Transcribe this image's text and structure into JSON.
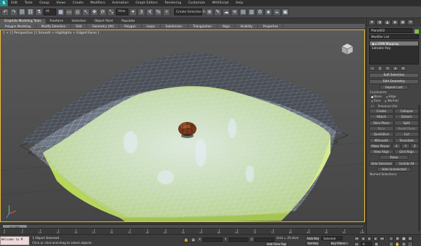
{
  "app": {
    "icon_letter": "S"
  },
  "menu": [
    "Edit",
    "Tools",
    "Group",
    "Views",
    "Create",
    "Modifiers",
    "Animation",
    "Graph Editors",
    "Rendering",
    "Customize",
    "MAXScript",
    "Help"
  ],
  "toolbar": {
    "buttons": [
      "↶",
      "↷",
      "⛓",
      "⛓",
      "⚗",
      "All",
      "▦",
      "▭",
      "◎",
      "↖",
      "✥",
      "⟳",
      "⤡",
      "View",
      "✦",
      "3",
      "∢",
      "%",
      "✧",
      "⊕",
      "✎",
      "☁",
      "≋",
      "▤",
      "▥",
      "⚙",
      "◈",
      "☕",
      "▣"
    ],
    "filter_dropdown": "All",
    "ref_dropdown": "View",
    "named_sel_dropdown": "Create Selection Se"
  },
  "ribbon": {
    "tabs": [
      "Graphite Modeling Tools",
      "Freeform",
      "Selection",
      "Object Paint",
      "Populate"
    ],
    "active_tab": 0,
    "panels": [
      "Polygon Modeling",
      "Modify Selection",
      "Edit",
      "Geometry (All)",
      "Polygon",
      "Loops",
      "Subdivision",
      "Triangulation",
      "Align",
      "Visibility",
      "Properties"
    ]
  },
  "viewport": {
    "label": "[ + ] [ Perspective ] [ Smooth + Highlights + Edged Faces ]",
    "active_border_color": "#f0c040",
    "mesh_color": "#d8e6f7",
    "ground_color": "#c6df8c",
    "ground_edge_color": "#dff27a",
    "dome_color": "#7a3a1e"
  },
  "command_panel": {
    "tab_icons": [
      "✚",
      "◑",
      "▲",
      "◉",
      "▣",
      "⚒"
    ],
    "object_name": "Plane002",
    "object_color": "#7cc43a",
    "modifier_list_label": "Modifier List",
    "stack": [
      {
        "label": "◉ ▸ UVW Mapping",
        "selected": true
      },
      {
        "label": "  Editable Poly",
        "selected": false
      }
    ],
    "stack_icons": [
      "⊣",
      "‖",
      "∀",
      "⊕",
      "☰"
    ],
    "rollouts": {
      "soft_selection": "Soft Selection",
      "edit_geometry": "Edit Geometry"
    },
    "repeat_last": "Repeat Last",
    "constraints_label": "Constraints",
    "constraint_options": [
      "None",
      "Edge",
      "Face",
      "Normal"
    ],
    "preserve_uvs": "Preserve UVs",
    "buttons": {
      "create": "Create",
      "collapse": "Collapse",
      "attach": "Attach",
      "detach": "Detach",
      "slice_plane": "Slice Plane",
      "split": "Split",
      "slice": "Slice",
      "reset_plane": "Reset Plane",
      "quickslice": "QuickSlice",
      "cut": "Cut",
      "msmooth": "MSmooth",
      "tessellate": "Tessellate",
      "make_planar": "Make Planar",
      "x": "X",
      "y": "Y",
      "z": "Z",
      "view_align": "View Align",
      "grid_align": "Grid Align",
      "relax": "Relax",
      "hide_selected": "Hide Selected",
      "unhide_all": "Unhide All",
      "hide_unselected": "Hide Unselected"
    },
    "named_selections": "Named Selections:"
  },
  "timeline": {
    "frame_readout": "0 / 100",
    "ticks": [
      "0",
      "5",
      "10",
      "15",
      "20",
      "25",
      "30",
      "35",
      "40",
      "45",
      "50",
      "55",
      "60",
      "65",
      "70",
      "75",
      "80",
      "85",
      "90",
      "95",
      "100"
    ]
  },
  "status": {
    "maxscript_text": "Welcome to M",
    "line1": "1 Object Selected",
    "line2": "Click or click-and-drag to select objects",
    "x_label": "X:",
    "y_label": "Y:",
    "z_label": "Z:",
    "grid": "Grid = 25.4cm",
    "add_time_tag": "Add Time Tag",
    "auto_key": "Auto Key",
    "selected_dropdown": "Selected",
    "set_key": "Set Key",
    "key_filters": "Key Filters...",
    "frame": "0"
  }
}
